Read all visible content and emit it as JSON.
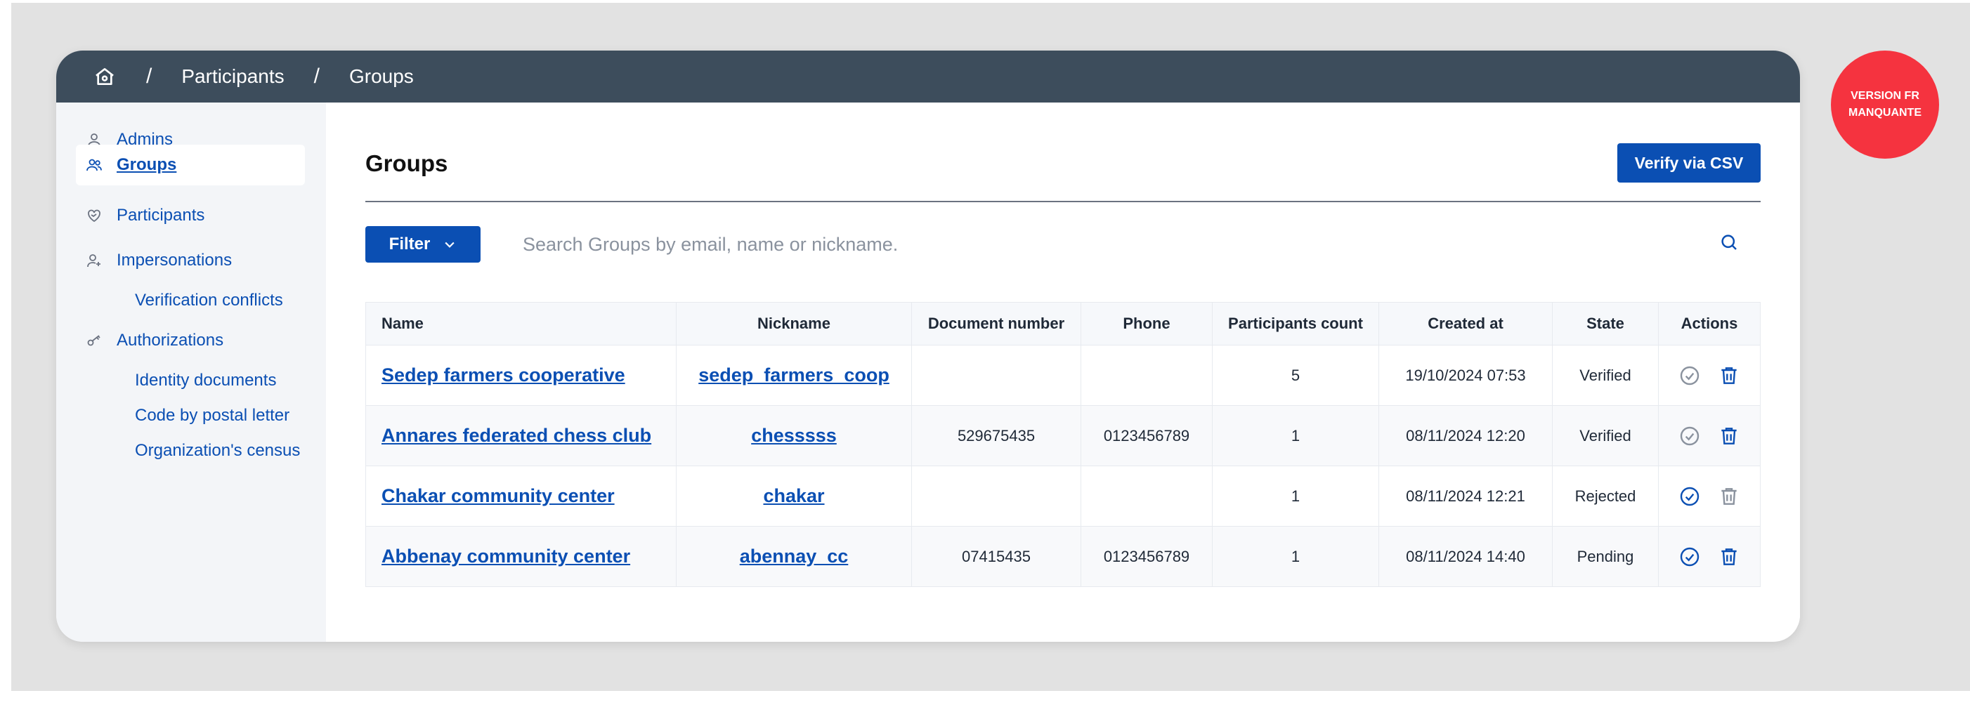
{
  "breadcrumb": {
    "home_icon": "home-icon",
    "items": [
      "Participants",
      "Groups"
    ],
    "separator": "/"
  },
  "sidebar": {
    "items": [
      {
        "label": "Admins",
        "icon": "user-icon"
      },
      {
        "label": "Groups",
        "icon": "users-icon",
        "active": true
      },
      {
        "label": "Participants",
        "icon": "heart-handshake-icon"
      },
      {
        "label": "Impersonations",
        "icon": "user-plus-icon"
      },
      {
        "label": "Verification conflicts"
      },
      {
        "label": "Authorizations",
        "icon": "key-icon"
      },
      {
        "label": "Identity documents"
      },
      {
        "label": "Code by postal letter"
      },
      {
        "label": "Organization's census"
      }
    ]
  },
  "main": {
    "title": "Groups",
    "verify_button": "Verify via CSV",
    "filter_button": "Filter",
    "search_placeholder": "Search Groups by email, name or nickname."
  },
  "table": {
    "columns": [
      "Name",
      "Nickname",
      "Document number",
      "Phone",
      "Participants count",
      "Created at",
      "State",
      "Actions"
    ],
    "rows": [
      {
        "name": "Sedep farmers cooperative",
        "nickname": "sedep_farmers_coop",
        "document": "",
        "phone": "",
        "count": "5",
        "created": "19/10/2024 07:53",
        "state": "Verified",
        "verify_active": false,
        "delete_active": true
      },
      {
        "name": "Annares federated chess club",
        "nickname": "chesssss",
        "document": "529675435",
        "phone": "0123456789",
        "count": "1",
        "created": "08/11/2024 12:20",
        "state": "Verified",
        "verify_active": false,
        "delete_active": true
      },
      {
        "name": "Chakar community center",
        "nickname": "chakar",
        "document": "",
        "phone": "",
        "count": "1",
        "created": "08/11/2024 12:21",
        "state": "Rejected",
        "verify_active": true,
        "delete_active": false
      },
      {
        "name": "Abbenay community center",
        "nickname": "abennay_cc",
        "document": "07415435",
        "phone": "0123456789",
        "count": "1",
        "created": "08/11/2024 14:40",
        "state": "Pending",
        "verify_active": true,
        "delete_active": true
      }
    ]
  },
  "badge": {
    "line1": "VERSION FR",
    "line2": "MANQUANTE"
  },
  "colors": {
    "accent": "#0b4fb3",
    "topbar": "#3d4d5c",
    "badge": "#f5333f"
  }
}
